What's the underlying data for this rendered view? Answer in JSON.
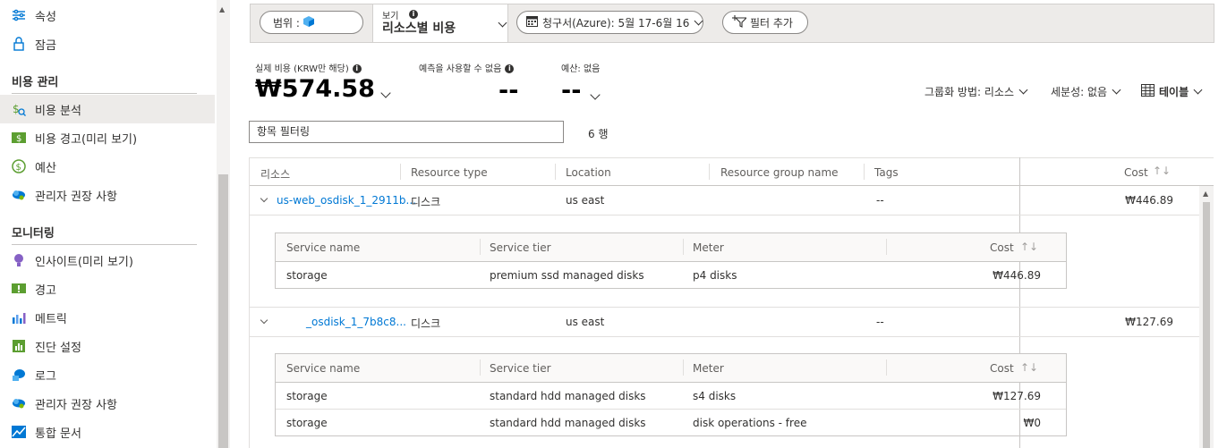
{
  "sidebar": {
    "items_top": [
      {
        "label": "속성",
        "icon": "properties-icon"
      },
      {
        "label": "잠금",
        "icon": "lock-icon"
      }
    ],
    "cost_section": "비용 관리",
    "cost_items": [
      {
        "label": "비용 분석",
        "icon": "cost-analysis-icon",
        "active": true
      },
      {
        "label": "비용 경고(미리 보기)",
        "icon": "cost-alert-icon"
      },
      {
        "label": "예산",
        "icon": "budget-icon"
      },
      {
        "label": "관리자 권장 사항",
        "icon": "advisor-icon"
      }
    ],
    "monitoring_section": "모니터링",
    "monitoring_items": [
      {
        "label": "인사이트(미리 보기)",
        "icon": "insights-icon"
      },
      {
        "label": "경고",
        "icon": "alerts-icon"
      },
      {
        "label": "메트릭",
        "icon": "metrics-icon"
      },
      {
        "label": "진단 설정",
        "icon": "diagnostics-icon"
      },
      {
        "label": "로그",
        "icon": "logs-icon"
      },
      {
        "label": "관리자 권장 사항",
        "icon": "advisor-icon"
      },
      {
        "label": "통합 문서",
        "icon": "workbooks-icon"
      }
    ]
  },
  "toolbar": {
    "scope_label": "범위 :",
    "view_label": "보기",
    "view_value": "리소스별 비용",
    "date_value": "청구서(Azure): 5월 17-6월 16",
    "add_filter": "필터 추가"
  },
  "kpis": {
    "actual_label": "실제 비용 (KRW만 해당)",
    "actual_value": "₩574.58",
    "forecast_label": "예측을 사용할 수 없음",
    "forecast_value": "--",
    "budget_label": "예산: 없음",
    "budget_value": "--"
  },
  "controls": {
    "group_by": "그룹화 방법: 리소스",
    "granularity": "세분성: 없음",
    "view_type": "테이블"
  },
  "filter": {
    "placeholder": "항목 필터링",
    "row_count": "6 행"
  },
  "grid": {
    "headers": {
      "resource": "리소스",
      "type": "Resource type",
      "location": "Location",
      "group": "Resource group name",
      "tags": "Tags",
      "cost": "Cost"
    },
    "sort_icon": "sort-icon",
    "rows": [
      {
        "resource": "us-web_osdisk_1_2911b...",
        "type": "디스크",
        "location": "us east",
        "group": "",
        "tags": "--",
        "cost": "₩446.89",
        "sub_headers": {
          "service": "Service name",
          "tier": "Service tier",
          "meter": "Meter",
          "cost": "Cost"
        },
        "sub_rows": [
          {
            "service": "storage",
            "tier": "premium ssd managed disks",
            "meter": "p4 disks",
            "cost": "₩446.89"
          }
        ]
      },
      {
        "resource": "_osdisk_1_7b8c8...",
        "type": "디스크",
        "location": "us east",
        "group": "",
        "tags": "--",
        "cost": "₩127.69",
        "sub_headers": {
          "service": "Service name",
          "tier": "Service tier",
          "meter": "Meter",
          "cost": "Cost"
        },
        "sub_rows": [
          {
            "service": "storage",
            "tier": "standard hdd managed disks",
            "meter": "s4 disks",
            "cost": "₩127.69"
          },
          {
            "service": "storage",
            "tier": "standard hdd managed disks",
            "meter": "disk operations - free",
            "cost": "₩0"
          }
        ]
      }
    ]
  },
  "colors": {
    "link": "#0078d4",
    "active_bg": "#edebe9",
    "toolbar_bg": "#edebe9"
  }
}
